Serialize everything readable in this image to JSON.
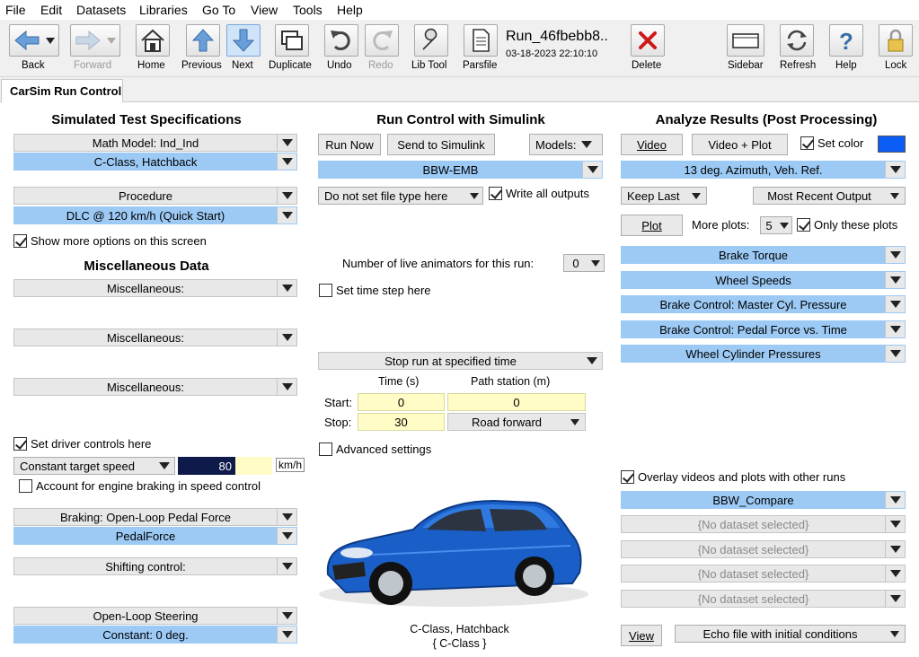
{
  "menu": [
    "File",
    "Edit",
    "Datasets",
    "Libraries",
    "Go To",
    "View",
    "Tools",
    "Help"
  ],
  "toolbar": {
    "back": "Back",
    "forward": "Forward",
    "home": "Home",
    "previous": "Previous",
    "next": "Next",
    "duplicate": "Duplicate",
    "undo": "Undo",
    "redo": "Redo",
    "libtool": "Lib Tool",
    "parsfile": "Parsfile",
    "run_title": "Run_46fbebb8..",
    "run_date": "03-18-2023 22:10:10",
    "delete": "Delete",
    "sidebar": "Sidebar",
    "refresh": "Refresh",
    "help": "Help",
    "lock": "Lock"
  },
  "tab": "CarSim Run Control",
  "left": {
    "heading": "Simulated Test Specifications",
    "math_model": "Math Model: Ind_Ind",
    "vehicle": "C-Class, Hatchback",
    "procedure": "Procedure",
    "procedure_value": "DLC @ 120 km/h (Quick Start)",
    "show_more": "Show more options on this screen",
    "misc_heading": "Miscellaneous Data",
    "misc1": "Miscellaneous:",
    "misc2": "Miscellaneous:",
    "misc3": "Miscellaneous:",
    "set_driver": "Set driver controls here",
    "speed_mode": "Constant target speed",
    "speed_value": "80",
    "speed_unit": "km/h",
    "engine_braking": "Account for engine braking in speed control",
    "braking": "Braking: Open-Loop Pedal Force",
    "braking_value": "PedalForce",
    "shifting": "Shifting control:",
    "steering": "Open-Loop Steering",
    "steering_value": "Constant: 0 deg."
  },
  "middle": {
    "heading": "Run Control with Simulink",
    "run_now": "Run Now",
    "send_simulink": "Send to Simulink",
    "models": "Models:",
    "model_value": "BBW-EMB",
    "file_type": "Do not set file type here",
    "write_outputs": "Write all outputs",
    "animators_label": "Number of live animators for this run:",
    "animators_value": "0",
    "set_time_step": "Set time step here",
    "stop_mode": "Stop run at specified time",
    "col_time": "Time (s)",
    "col_station": "Path station (m)",
    "start_label": "Start:",
    "stop_label": "Stop:",
    "start_time": "0",
    "start_station": "0",
    "stop_time": "30",
    "stop_station": "Road forward",
    "advanced": "Advanced settings",
    "car_name": "C-Class, Hatchback",
    "car_sub": "{ C-Class }"
  },
  "right": {
    "heading": "Analyze Results (Post Processing)",
    "video": "Video",
    "video_plot": "Video + Plot",
    "set_color": "Set color",
    "color_swatch": "#0a5cf5",
    "camera": "13 deg. Azimuth, Veh. Ref.",
    "keep_last": "Keep Last",
    "recent_output": "Most Recent Output",
    "plot": "Plot",
    "more_plots": "More plots:",
    "more_plots_value": "5",
    "only_these": "Only these plots",
    "plots": [
      "Brake Torque",
      "Wheel Speeds",
      "Brake Control: Master Cyl. Pressure",
      "Brake Control: Pedal Force vs. Time",
      "Wheel Cylinder Pressures"
    ],
    "overlay": "Overlay videos and plots with other runs",
    "overlay_runs": [
      "BBW_Compare",
      "{No dataset selected}",
      "{No dataset selected}",
      "{No dataset selected}",
      "{No dataset selected}"
    ],
    "view": "View",
    "echo": "Echo file with initial conditions"
  }
}
